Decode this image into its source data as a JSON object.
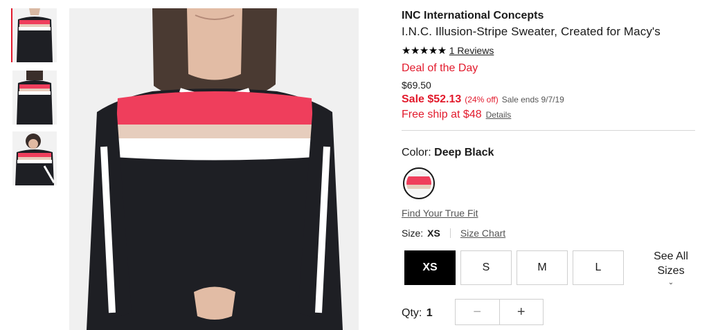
{
  "product": {
    "brand": "INC International Concepts",
    "name": "I.N.C. Illusion-Stripe Sweater, Created for Macy's",
    "stars": "★★★★★",
    "reviews_link": "1 Reviews",
    "deal_label": "Deal of the Day",
    "original_price": "$69.50",
    "sale_price": "Sale $52.13",
    "discount": "(24% off)",
    "sale_ends": "Sale ends 9/7/19",
    "free_ship": "Free ship at $48",
    "ship_details_link": "Details"
  },
  "color": {
    "label": "Color:",
    "selected": "Deep Black"
  },
  "fit_link": "Find Your True Fit",
  "size": {
    "label": "Size:",
    "selected": "XS",
    "chart_link": "Size Chart",
    "options": [
      "XS",
      "S",
      "M",
      "L"
    ],
    "see_all_line1": "See All",
    "see_all_line2": "Sizes"
  },
  "qty": {
    "label": "Qty:",
    "value": "1",
    "minus": "−",
    "plus": "+"
  },
  "icons": {
    "chevron": "⌄"
  },
  "colors": {
    "accent_red": "#e21a2c",
    "stripe_pink": "#ef3e5c",
    "stripe_beige": "#e6cdbd",
    "sweater_black": "#1e1f24"
  }
}
